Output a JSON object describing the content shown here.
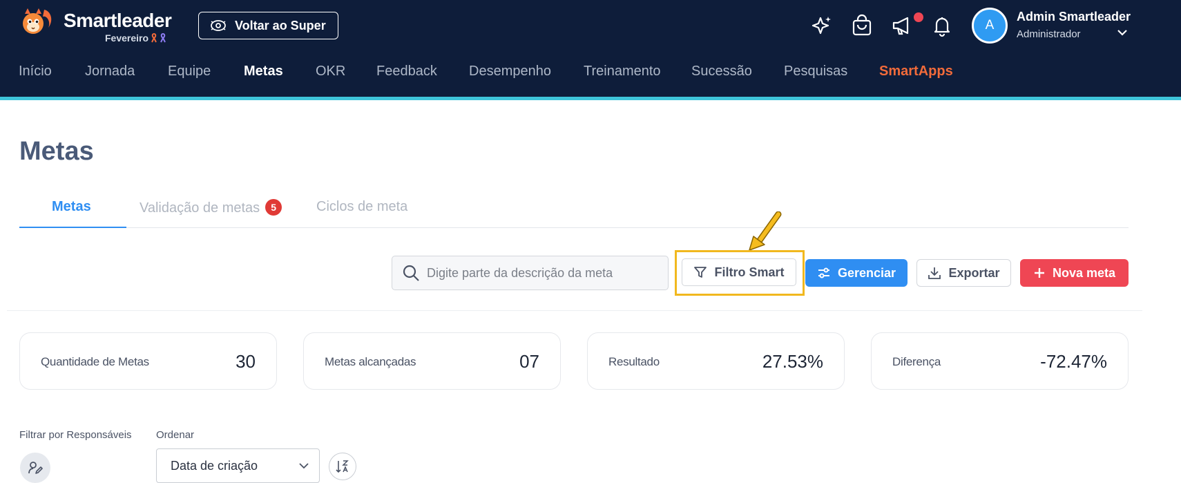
{
  "header": {
    "brand": "Smartleader",
    "brand_sub": "Fevereiro",
    "voltar_label": "Voltar ao Super",
    "icons": [
      "sparkle-icon",
      "shopping-bag-icon",
      "megaphone-icon",
      "bell-icon"
    ],
    "user": {
      "initial": "A",
      "name": "Admin Smartleader",
      "role": "Administrador"
    },
    "nav": [
      {
        "label": "Início",
        "active": false
      },
      {
        "label": "Jornada",
        "active": false
      },
      {
        "label": "Equipe",
        "active": false
      },
      {
        "label": "Metas",
        "active": true
      },
      {
        "label": "OKR",
        "active": false
      },
      {
        "label": "Feedback",
        "active": false
      },
      {
        "label": "Desempenho",
        "active": false
      },
      {
        "label": "Treinamento",
        "active": false
      },
      {
        "label": "Sucessão",
        "active": false
      },
      {
        "label": "Pesquisas",
        "active": false
      },
      {
        "label": "SmartApps",
        "active": false
      }
    ],
    "colors": {
      "background": "#0e1d3a",
      "accent_line": "#3ec4d9",
      "smartapps": "#f26b3a"
    }
  },
  "page": {
    "title": "Metas",
    "tabs": [
      {
        "label": "Metas",
        "active": true
      },
      {
        "label": "Validação de metas",
        "badge": "5"
      },
      {
        "label": "Ciclos de meta"
      }
    ]
  },
  "toolbar": {
    "search_placeholder": "Digite parte da descrição da meta",
    "filtro_label": "Filtro Smart",
    "gerenciar_label": "Gerenciar",
    "exportar_label": "Exportar",
    "nova_label": "Nova meta"
  },
  "stats": [
    {
      "label": "Quantidade de Metas",
      "value": "30"
    },
    {
      "label": "Metas alcançadas",
      "value": "07"
    },
    {
      "label": "Resultado",
      "value": "27.53%"
    },
    {
      "label": "Diferença",
      "value": "-72.47%"
    }
  ],
  "filters": {
    "responsaveis_label": "Filtrar por Responsáveis",
    "ordenar_label": "Ordenar",
    "ordenar_value": "Data de criação"
  }
}
